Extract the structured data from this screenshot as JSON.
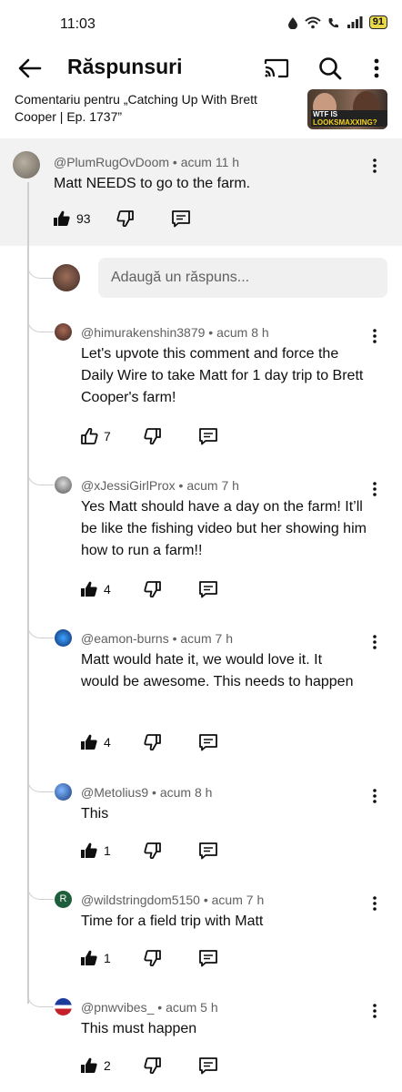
{
  "status_bar": {
    "time": "11:03",
    "battery": "91"
  },
  "header": {
    "title": "Răspunsuri"
  },
  "context": {
    "text": "Comentariu pentru „Catching Up With Brett Cooper | Ep. 1737”",
    "thumb_caption_1": "WTF IS ",
    "thumb_caption_2": "LOOKSMAXXING?"
  },
  "top_comment": {
    "author": "@PlumRugOvDoom",
    "time": "acum 11 h",
    "text": "Matt NEEDS to go to the farm.",
    "likes": "93"
  },
  "reply_input": {
    "placeholder": "Adaugă un răspuns..."
  },
  "replies": [
    {
      "author": "@himurakenshin3879",
      "time": "acum 8 h",
      "text": "Let's upvote this comment and force the Daily Wire to take Matt for 1 day trip to Brett Cooper's farm!",
      "likes": "7"
    },
    {
      "author": "@xJessiGirlProx",
      "time": "acum 7 h",
      "text": "Yes Matt should have a day on the farm! It’ll be like the fishing video but her showing him how to run a farm!!",
      "likes": "4"
    },
    {
      "author": "@eamon-burns",
      "time": "acum 7 h",
      "text": "Matt would hate it, we would love it. It would be awesome. This needs to happen",
      "likes": "4"
    },
    {
      "author": "@Metolius9",
      "time": "acum 8 h",
      "text": "This",
      "likes": "1"
    },
    {
      "author": "@wildstringdom5150",
      "time": "acum 7 h",
      "text": "Time for a field trip with Matt",
      "likes": "1",
      "avatar_letter": "R"
    },
    {
      "author": "@pnwvibes_",
      "time": "acum 5 h",
      "text": "This must happen",
      "likes": "2"
    }
  ],
  "separator": " • "
}
